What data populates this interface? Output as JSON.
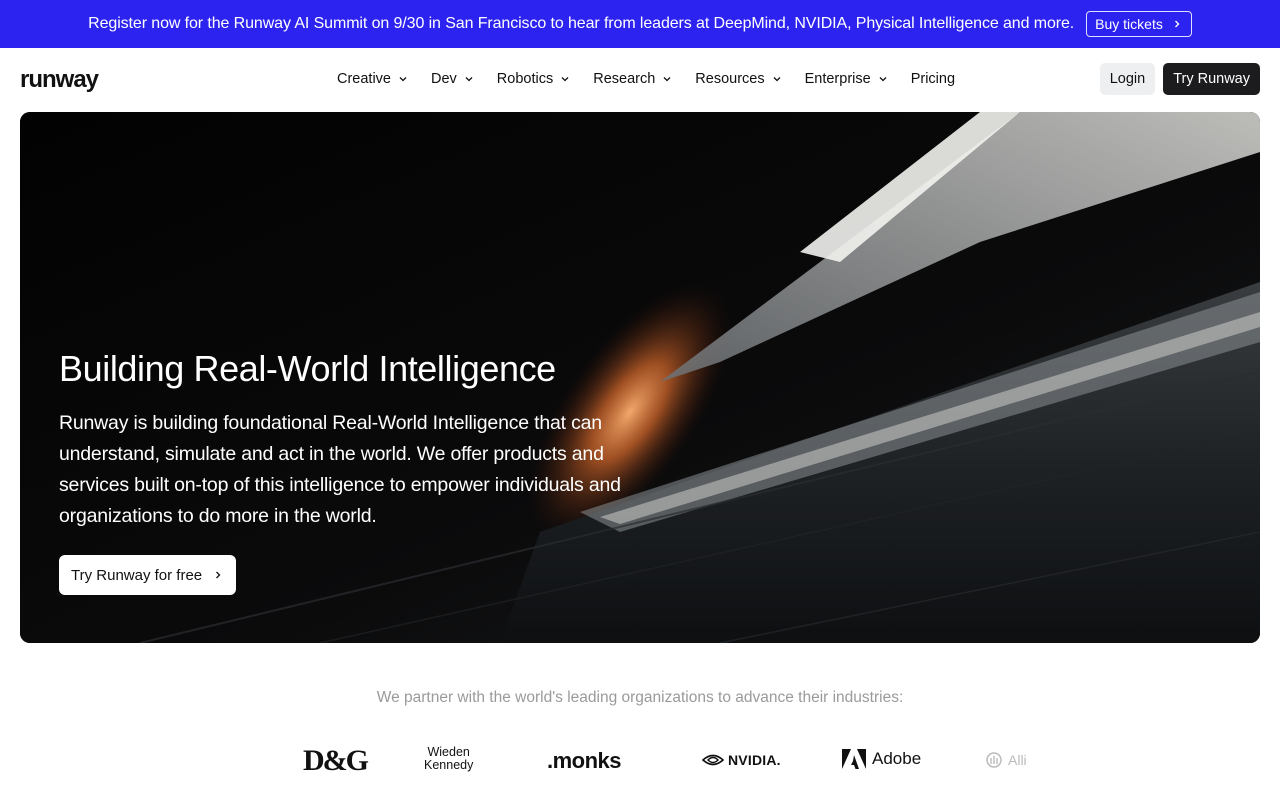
{
  "announcement": {
    "text": "Register now for the Runway AI Summit on 9/30 in San Francisco to hear from leaders at DeepMind, NVIDIA, Physical Intelligence and more.",
    "button_label": "Buy tickets",
    "background": "#2d23f0"
  },
  "header": {
    "logo": "runway",
    "menu": [
      {
        "label": "Creative",
        "has_dropdown": true
      },
      {
        "label": "Dev",
        "has_dropdown": true
      },
      {
        "label": "Robotics",
        "has_dropdown": true
      },
      {
        "label": "Research",
        "has_dropdown": true
      },
      {
        "label": "Resources",
        "has_dropdown": true
      },
      {
        "label": "Enterprise",
        "has_dropdown": true
      },
      {
        "label": "Pricing",
        "has_dropdown": false
      }
    ],
    "login_label": "Login",
    "try_label": "Try Runway"
  },
  "hero": {
    "title": "Building Real-World Intelligence",
    "description": "Runway is building foundational Real-World Intelligence that can understand, simulate and act in the world. We offer products and services built on-top of this intelligence to empower individuals and organizations to do more in the world.",
    "cta_label": "Try Runway for free"
  },
  "partners": {
    "title": "We partner with the world's leading organizations to advance their industries:",
    "logos": {
      "dg": "D&G",
      "wieden_line1": "Wieden",
      "wieden_line2": "Kennedy",
      "monks": ".monks",
      "nvidia": "NVIDIA.",
      "adobe": "Adobe",
      "allianz": "Alli"
    }
  }
}
